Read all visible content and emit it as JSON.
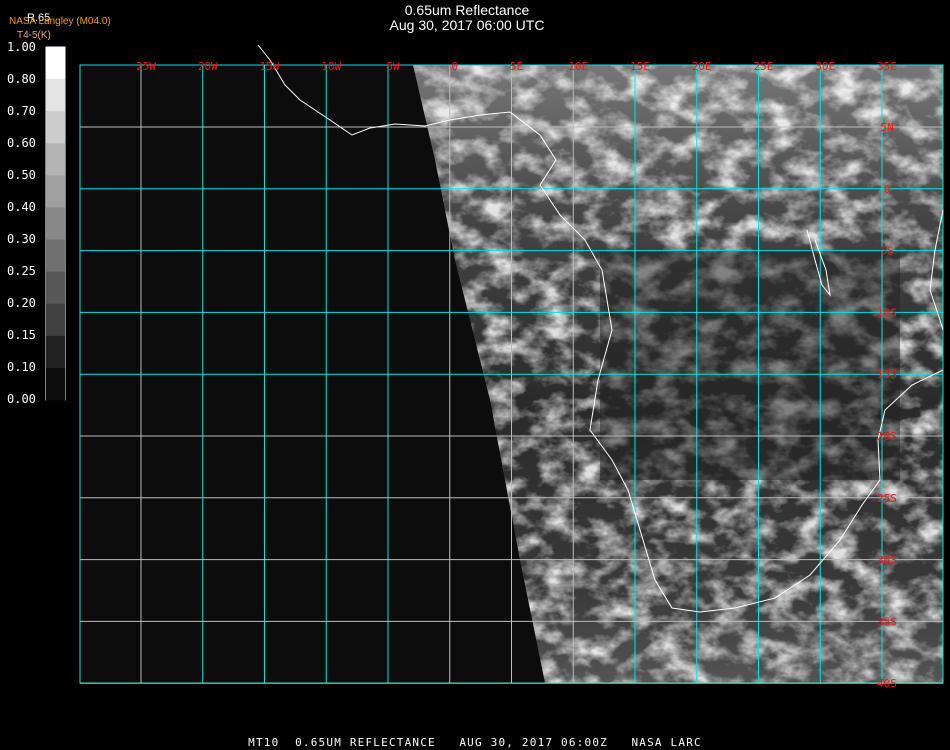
{
  "header": {
    "title": "0.65um Reflectance",
    "datetime": "Aug 30, 2017 06:00 UTC",
    "source": "NASA Langley (M04.0)",
    "product_label": "R.65",
    "sub_label": "T4-5(K)"
  },
  "colorbar": {
    "labels": [
      "1.00",
      "0.80",
      "0.70",
      "0.60",
      "0.50",
      "0.40",
      "0.30",
      "0.25",
      "0.20",
      "0.15",
      "0.10",
      "0.00"
    ],
    "colors": [
      "#ffffff",
      "#e4e4e4",
      "#cccccc",
      "#b4b4b4",
      "#a0a0a0",
      "#888888",
      "#707070",
      "#585858",
      "#404040",
      "#222222",
      "#0c0c0c"
    ]
  },
  "map": {
    "lon_labels": [
      "25W",
      "20W",
      "15W",
      "10W",
      "5W",
      "0",
      "5E",
      "10E",
      "15E",
      "20E",
      "25E",
      "30E",
      "35E"
    ],
    "lat_labels": [
      "5N",
      "0",
      "5S",
      "10S",
      "15S",
      "20S",
      "25S",
      "30S",
      "35S",
      "40S"
    ],
    "grid_color": "#00e5e5",
    "label_color": "#ff1010"
  },
  "footer": {
    "text": "MT10  0.65UM REFLECTANCE   AUG 30, 2017 06:00Z   NASA LARC"
  }
}
